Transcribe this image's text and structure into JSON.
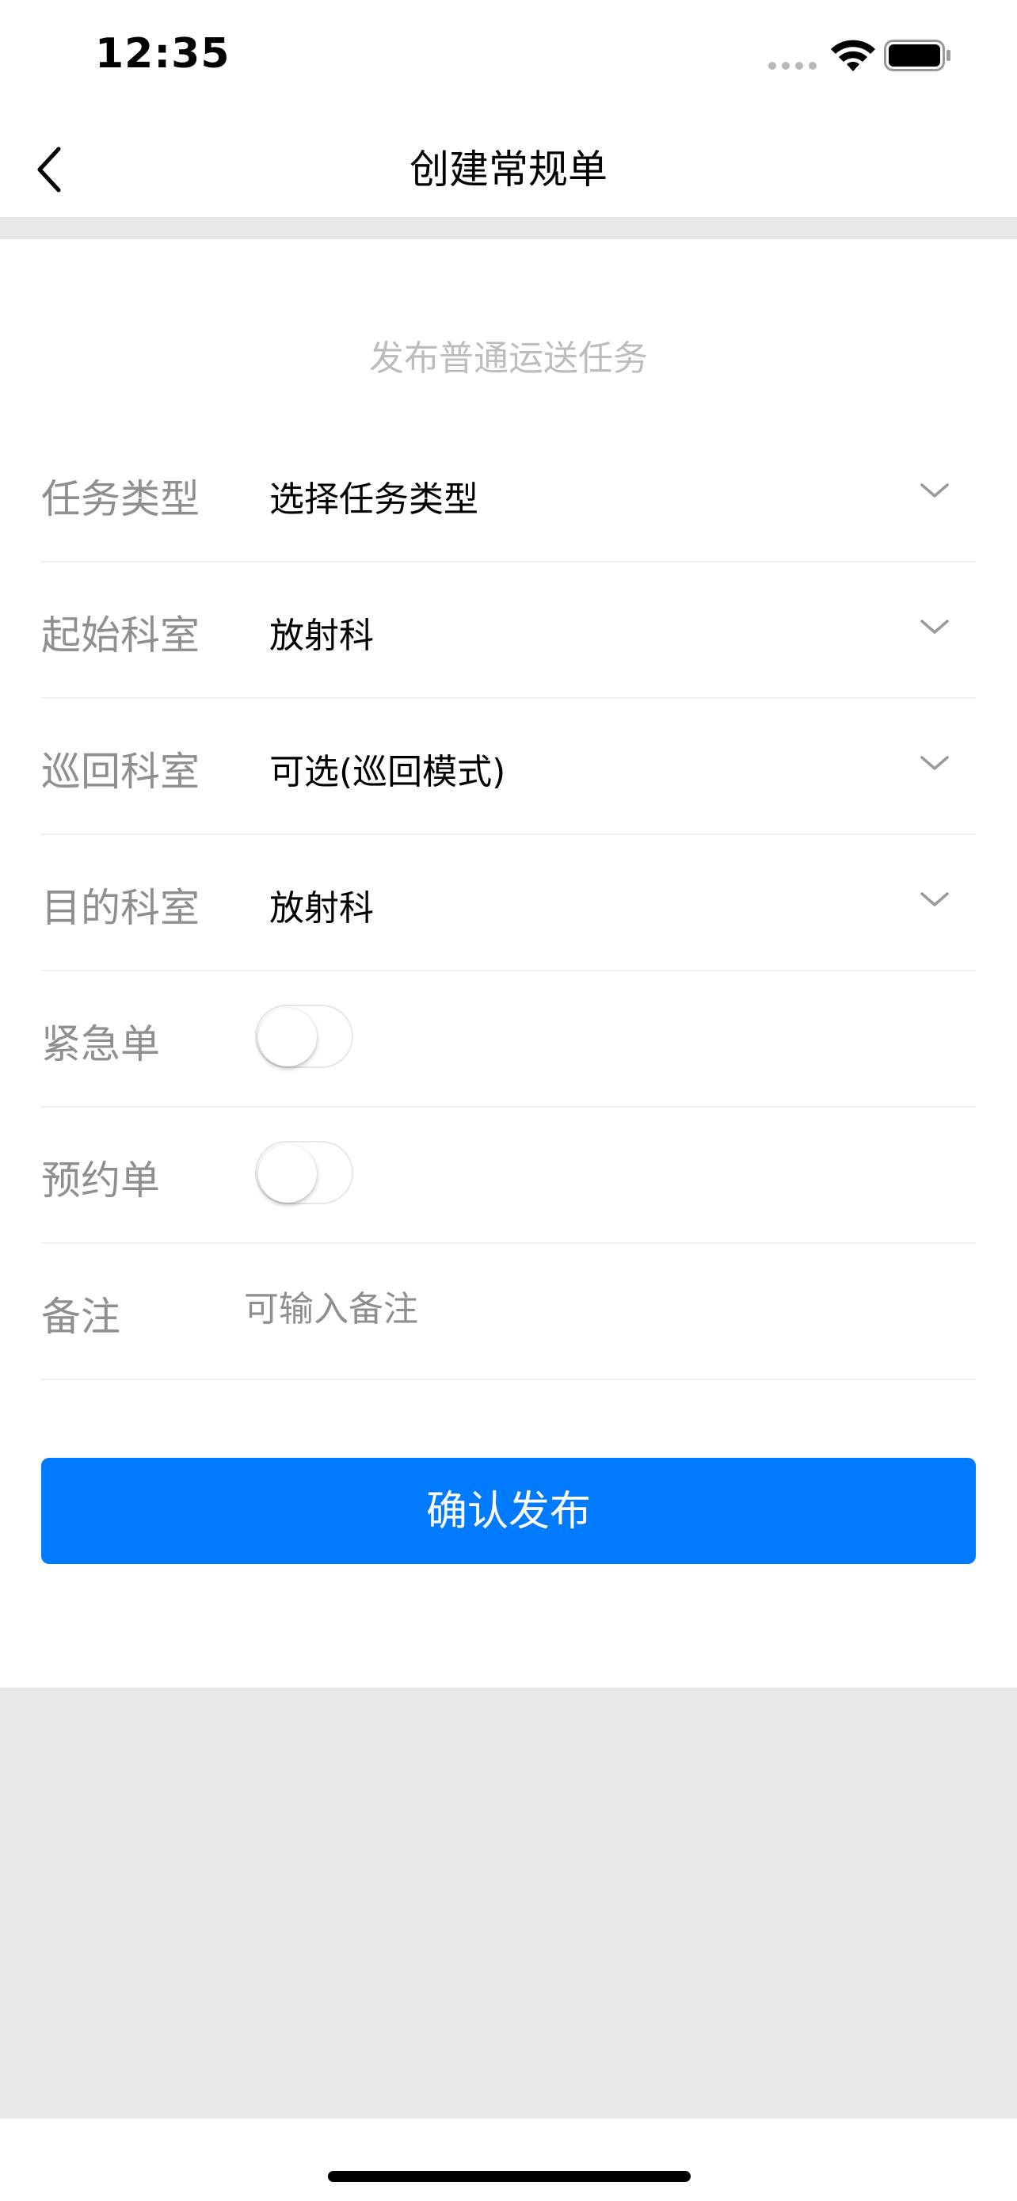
{
  "status_bar": {
    "time": "12:35"
  },
  "nav": {
    "title": "创建常规单"
  },
  "form": {
    "subtitle": "发布普通运送任务",
    "task_type": {
      "label": "任务类型",
      "value": "选择任务类型"
    },
    "start_dept": {
      "label": "起始科室",
      "value": "放射科"
    },
    "patrol_dept": {
      "label": "巡回科室",
      "value": "可选(巡回模式)"
    },
    "dest_dept": {
      "label": "目的科室",
      "value": "放射科"
    },
    "urgent": {
      "label": "紧急单",
      "on": false
    },
    "reservation": {
      "label": "预约单",
      "on": false
    },
    "remark": {
      "label": "备注",
      "placeholder": "可输入备注",
      "value": ""
    }
  },
  "submit_label": "确认发布",
  "colors": {
    "primary": "#007aff",
    "label": "#8e8e93",
    "placeholder": "#bdbdbd",
    "background_gray": "#e8e8e8"
  }
}
